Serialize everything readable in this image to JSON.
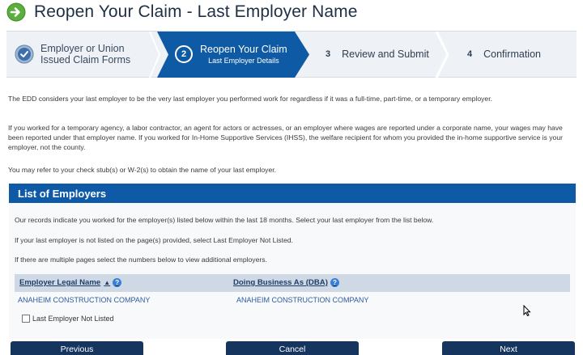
{
  "page": {
    "title": "Reopen Your Claim - Last Employer Name"
  },
  "stepper": {
    "step1": {
      "label_line1": "Employer or Union",
      "label_line2": "Issued Claim Forms"
    },
    "step2": {
      "number": "2",
      "label_main": "Reopen Your Claim",
      "label_sub": "Last Employer Details"
    },
    "step3": {
      "number": "3",
      "label": "Review and Submit"
    },
    "step4": {
      "number": "4",
      "label": "Confirmation"
    }
  },
  "intro": {
    "p1": "The EDD considers your last employer to be the very last employer you performed work for regardless if it was a full-time, part-time, or a temporary employer.",
    "p2": "If you worked for a temporary agency, a labor contractor, an agent for actors or actresses, or an employer where wages are reported under a corporate name, your wages may have been reported under that employer name. If you worked for In-Home Supportive Services (IHSS), the welfare recipient for whom you provided the in-home supportive service is your employer, not the county.",
    "p3": "You may refer to your check stub(s) or W-2(s) to obtain the name of your last employer."
  },
  "employers": {
    "header": "List of Employers",
    "line1": "Our records indicate you worked for the employer(s) listed below within the last 18 months. Select your last employer from the list below.",
    "line2": "If your last employer is not listed on the page(s) provided, select Last Employer Not Listed.",
    "line3": "If there are multiple pages select the numbers below to view additional employers.",
    "columns": {
      "legal_name": "Employer Legal Name",
      "dba": "Doing Business As (DBA)"
    },
    "rows": [
      {
        "legal_name": "ANAHEIM CONSTRUCTION COMPANY",
        "dba": "ANAHEIM CONSTRUCTION COMPANY"
      }
    ],
    "not_listed_label": "Last Employer Not Listed",
    "not_listed_checked": false
  },
  "buttons": {
    "previous": "Previous",
    "cancel": "Cancel",
    "next": "Next"
  },
  "colors": {
    "accent": "#0f5aa6",
    "button": "#16355e",
    "link": "#2b5c9e"
  }
}
